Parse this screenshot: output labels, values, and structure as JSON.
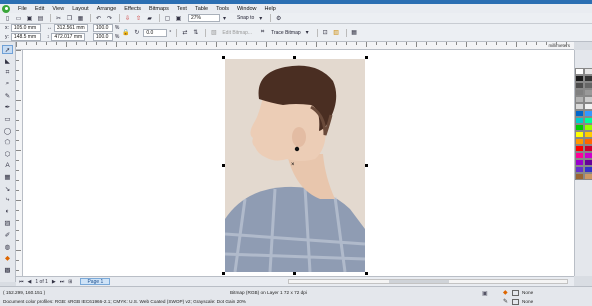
{
  "menu": [
    "File",
    "Edit",
    "View",
    "Layout",
    "Arrange",
    "Effects",
    "Bitmaps",
    "Text",
    "Table",
    "Tools",
    "Window",
    "Help"
  ],
  "toolbar": {
    "zoom": "27%",
    "snap_to": "Snap to"
  },
  "propbar": {
    "x_label": "x:",
    "x_value": "105.0 mm",
    "y_label": "y:",
    "y_value": "148.5 mm",
    "w_value": "312.561 mm",
    "h_value": "472.017 mm",
    "scale_w": "100.0",
    "scale_h": "100.0",
    "percent": "%",
    "rotation": "0.0",
    "edit_bitmap": "Edit Bitmap...",
    "trace_bitmap": "Trace Bitmap"
  },
  "ruler": {
    "unit": "millimeters"
  },
  "pagebar": {
    "page_count": "1 of 1",
    "page_tab": "Page 1"
  },
  "status": {
    "cursor": "( 152.299, 160.151 )",
    "object_info": "Bitmap (RGB) on Layer 1 72 x 72 dpi",
    "color_profiles": "Document color profiles: RGB: sRGB IEC61966-2.1; CMYK: U.S. Web Coated (SWOP) v2; Grayscale: Dot Gain 20%",
    "fill": "None",
    "outline": "None"
  },
  "palette_colors": [
    "#ffffff",
    "#e6e6e6",
    "#1a1a1a",
    "#333333",
    "#4d4d4d",
    "#666666",
    "#808080",
    "#999999",
    "#b3b3b3",
    "#cccccc",
    "#d9d9d9",
    "#f2f2f2",
    "#0066cc",
    "#3399ff",
    "#00cccc",
    "#00ff99",
    "#00cc00",
    "#99ff00",
    "#ffff00",
    "#ffcc00",
    "#ff9900",
    "#ff6600",
    "#ff0000",
    "#cc0033",
    "#ff0099",
    "#cc00cc",
    "#9900cc",
    "#660099",
    "#6633cc",
    "#3333cc",
    "#996633",
    "#cc9966"
  ]
}
